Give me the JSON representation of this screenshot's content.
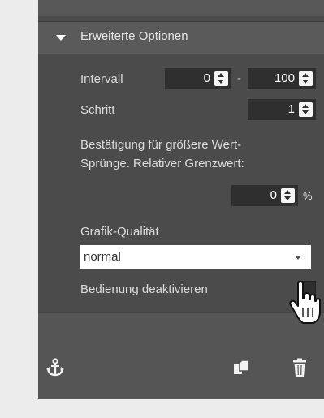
{
  "section": {
    "title": "Erweiterte Optionen"
  },
  "interval": {
    "label": "Intervall",
    "min_value": "0",
    "separator": "-",
    "max_value": "100"
  },
  "step": {
    "label": "Schritt",
    "value": "1"
  },
  "threshold": {
    "label_line1": "Bestätigung für größere Wert-",
    "label_line2": "Sprünge. Relativer Grenzwert:",
    "value": "0",
    "unit": "%"
  },
  "graphics_quality": {
    "label": "Grafik-Qualität",
    "selected": "normal"
  },
  "disable_control": {
    "label": "Bedienung deaktivieren",
    "checked": false
  },
  "footer_icons": [
    "anchor-icon",
    "copy-icon",
    "trash-icon"
  ],
  "colors": {
    "panel_bg": "#4b4b4b",
    "input_bg": "#2f2f2f",
    "footer_bg": "#555555"
  }
}
